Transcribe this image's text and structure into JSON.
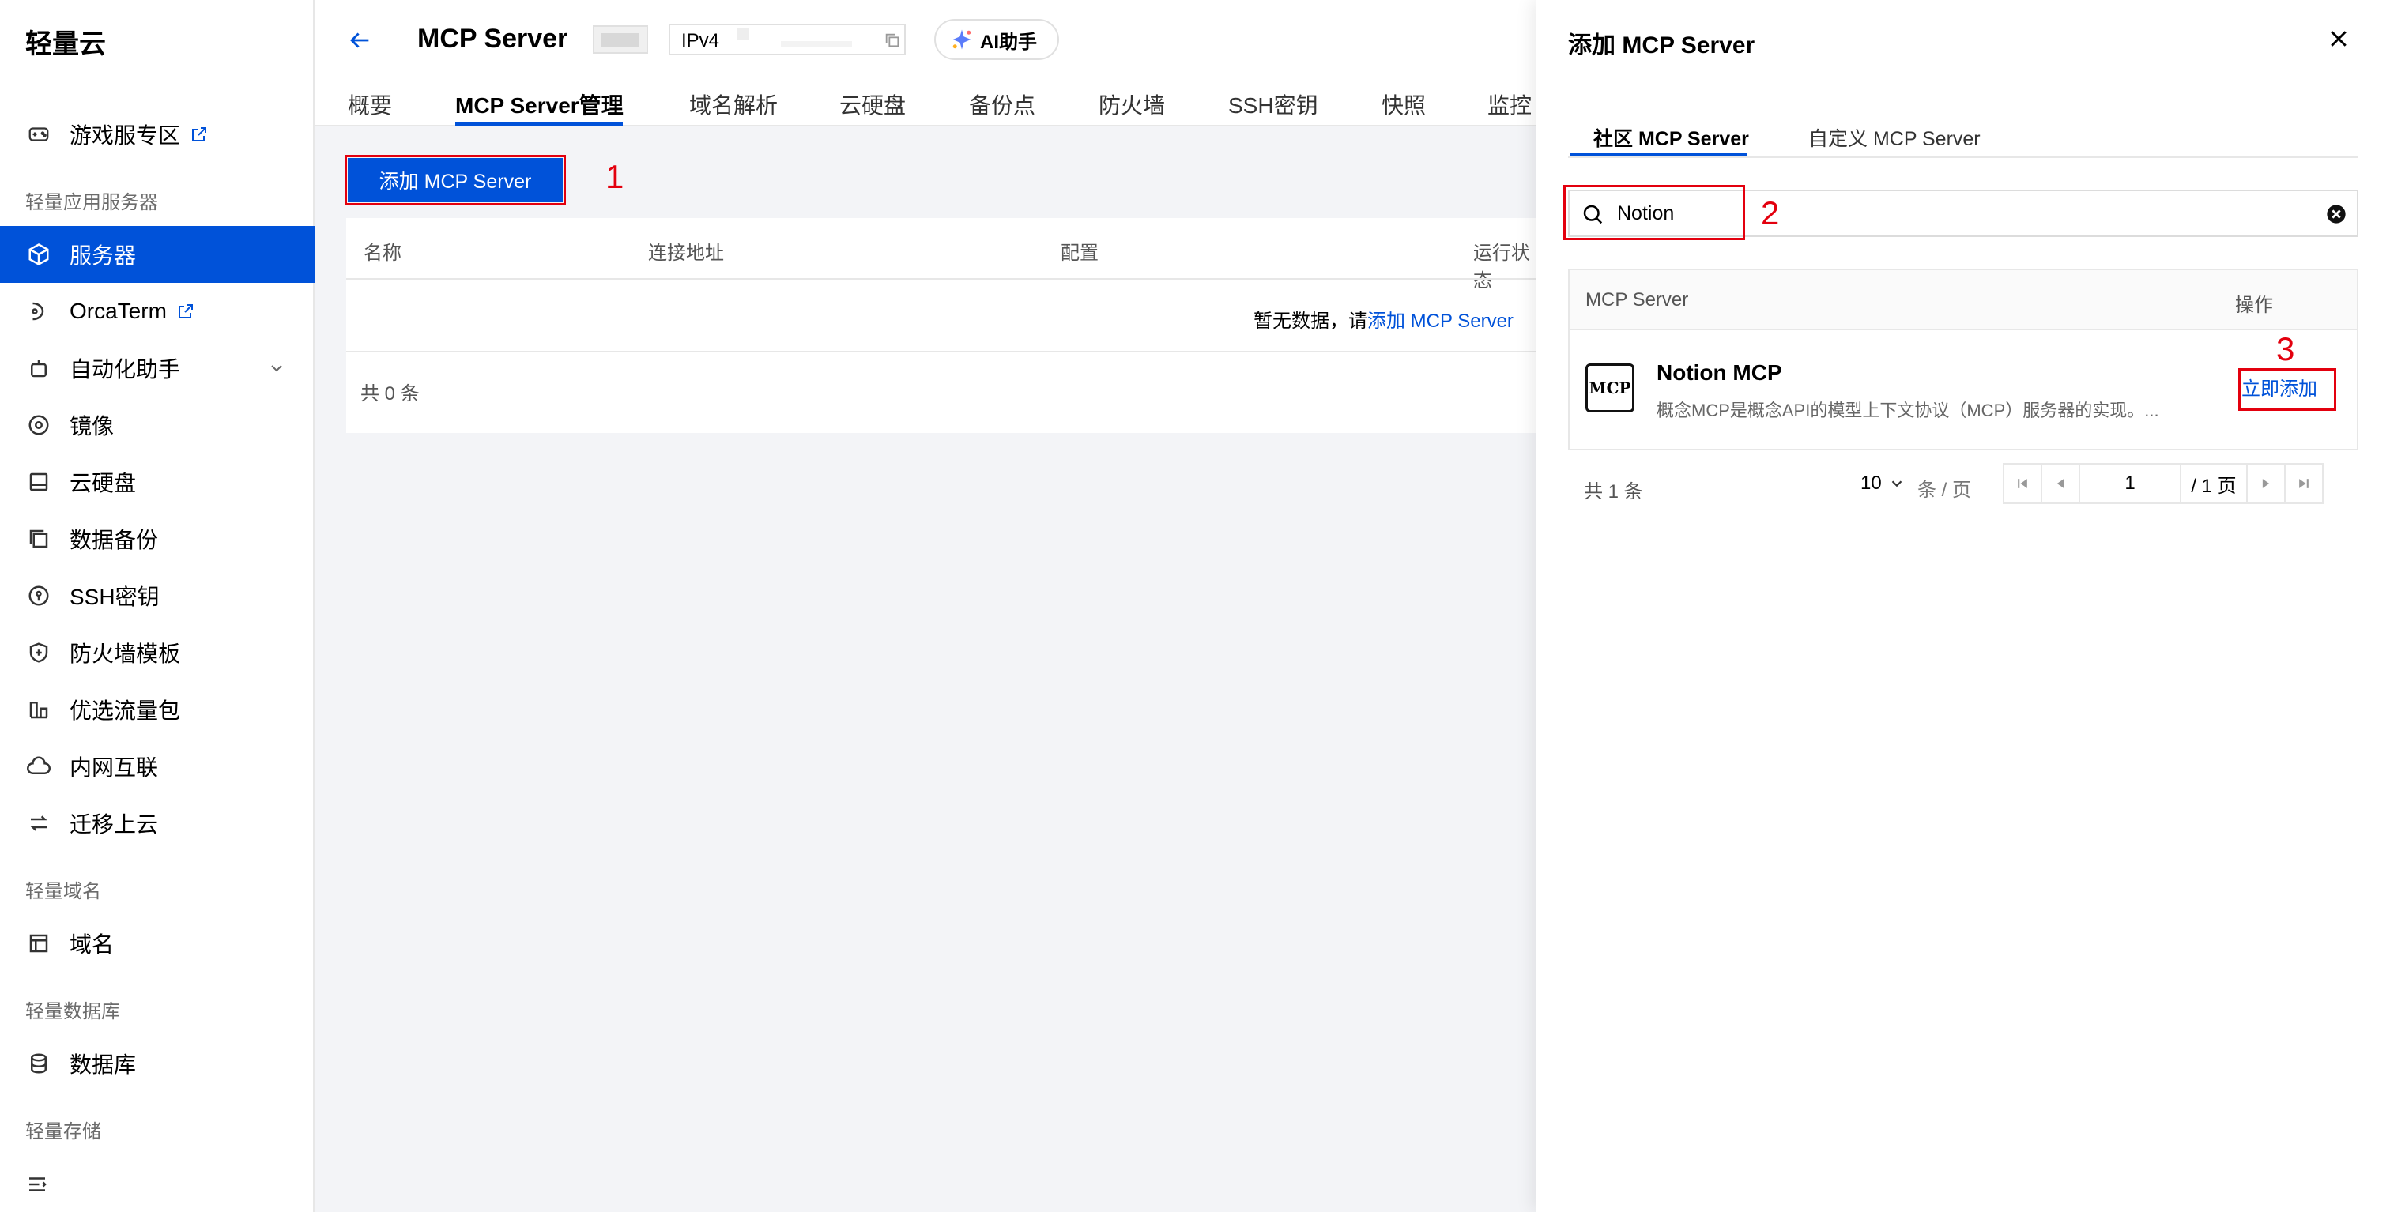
{
  "sidebar": {
    "brand": "轻量云",
    "items": [
      {
        "label": "游戏服专区",
        "icon": "gamepad-icon"
      },
      {
        "label": "服务器",
        "icon": "cube-icon"
      },
      {
        "label": "OrcaTerm",
        "icon": "terminal-icon"
      },
      {
        "label": "自动化助手",
        "icon": "robot-icon"
      },
      {
        "label": "镜像",
        "icon": "disc-icon"
      },
      {
        "label": "云硬盘",
        "icon": "disk-icon"
      },
      {
        "label": "数据备份",
        "icon": "backup-icon"
      },
      {
        "label": "SSH密钥",
        "icon": "key-icon"
      },
      {
        "label": "防火墙模板",
        "icon": "shield-icon"
      },
      {
        "label": "优选流量包",
        "icon": "chart-icon"
      },
      {
        "label": "内网互联",
        "icon": "network-icon"
      },
      {
        "label": "迁移上云",
        "icon": "migrate-icon"
      },
      {
        "label": "域名",
        "icon": "domain-icon"
      },
      {
        "label": "数据库",
        "icon": "database-icon"
      }
    ],
    "groups": [
      "轻量应用服务器",
      "轻量域名",
      "轻量数据库",
      "轻量存储"
    ]
  },
  "header": {
    "title": "MCP Server",
    "ip_label": "IPv4",
    "ai_label": "AI助手"
  },
  "tabs": [
    "概要",
    "MCP Server管理",
    "域名解析",
    "云硬盘",
    "备份点",
    "防火墙",
    "SSH密钥",
    "快照",
    "监控"
  ],
  "main": {
    "add_button": "添加 MCP Server",
    "annotation_1": "1",
    "columns": [
      "名称",
      "连接地址",
      "配置",
      "运行状态"
    ],
    "empty_text": "暂无数据，请",
    "empty_link": "添加 MCP Server",
    "total": "共 0 条"
  },
  "drawer": {
    "title": "添加 MCP Server",
    "tabs": [
      "社区 MCP Server",
      "自定义 MCP Server"
    ],
    "search_value": "Notion",
    "annotation_2": "2",
    "annotation_3": "3",
    "col_server": "MCP Server",
    "col_action": "操作",
    "item_name": "Notion MCP",
    "item_desc": "概念MCP是概念API的模型上下文协议（MCP）服务器的实现。...",
    "item_logo": "MCP",
    "add_now": "立即添加",
    "total": "共 1 条",
    "page_size": "10",
    "page_unit": "条 / 页",
    "page_current": "1",
    "page_total": "/ 1 页"
  },
  "colors": {
    "primary": "#0052d9",
    "annotation": "#e3000e"
  }
}
